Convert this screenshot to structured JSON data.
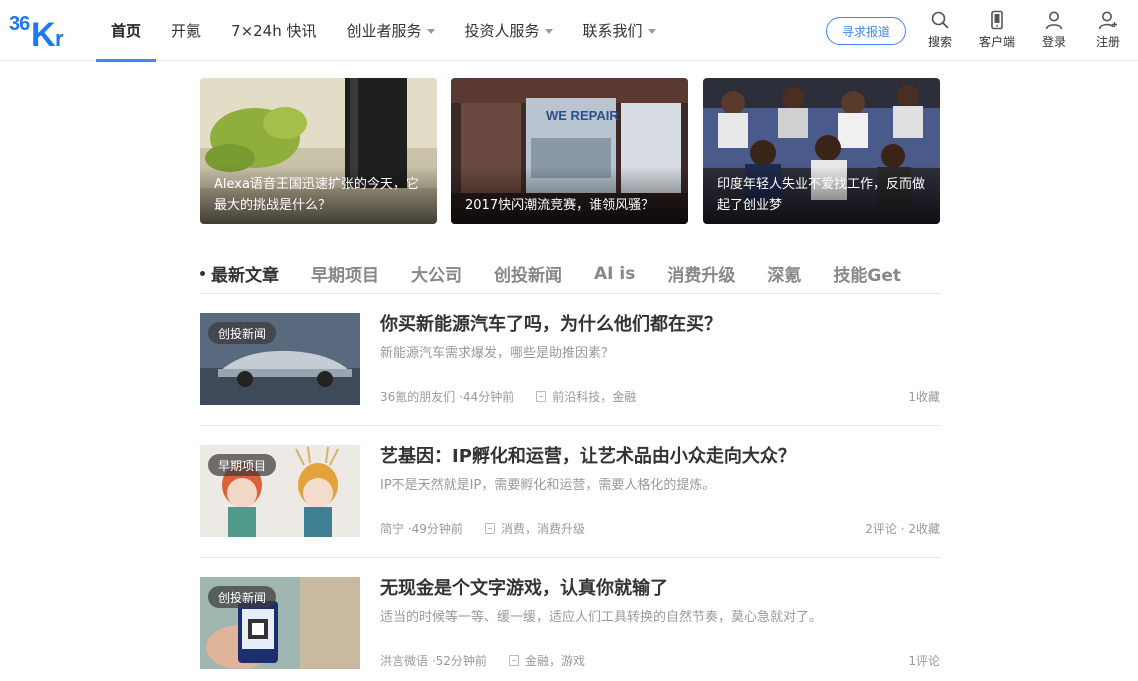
{
  "header": {
    "logo_text": "36Kr",
    "nav": [
      {
        "label": "首页",
        "active": true,
        "dropdown": false
      },
      {
        "label": "开氪",
        "active": false,
        "dropdown": false
      },
      {
        "label": "7×24h 快讯",
        "active": false,
        "dropdown": false
      },
      {
        "label": "创业者服务",
        "active": false,
        "dropdown": true
      },
      {
        "label": "投资人服务",
        "active": false,
        "dropdown": true
      },
      {
        "label": "联系我们",
        "active": false,
        "dropdown": true
      }
    ],
    "seek_report": "寻求报道",
    "icons": [
      {
        "icon": "search-icon",
        "label": "搜索"
      },
      {
        "icon": "mobile-icon",
        "label": "客户端"
      },
      {
        "icon": "user-icon",
        "label": "登录"
      },
      {
        "icon": "add-user-icon",
        "label": "注册"
      }
    ]
  },
  "featured": [
    {
      "caption": "Alexa语音王国迅速扩张的今天，它最大的挑战是什么？"
    },
    {
      "caption": "2017快闪潮流竞赛，谁领风骚？"
    },
    {
      "caption": "印度年轻人失业不爱找工作，反而做起了创业梦"
    }
  ],
  "tabs": [
    "最新文章",
    "早期项目",
    "大公司",
    "创投新闻",
    "AI is",
    "消费升级",
    "深氪",
    "技能Get"
  ],
  "articles": [
    {
      "badge": "创投新闻",
      "title": "你买新能源汽车了吗，为什么他们都在买？",
      "summary": "新能源汽车需求爆发，哪些是助推因素？",
      "author": "36氪的朋友们",
      "time": "44分钟前",
      "tags": "前沿科技，金融",
      "stats": "1收藏"
    },
    {
      "badge": "早期项目",
      "title": "艺基因：IP孵化和运营，让艺术品由小众走向大众？",
      "summary": "IP不是天然就是IP，需要孵化和运营，需要人格化的提炼。",
      "author": "简宁",
      "time": "49分钟前",
      "tags": "消费，消费升级",
      "stats": "2评论 · 2收藏"
    },
    {
      "badge": "创投新闻",
      "title": "无现金是个文字游戏，认真你就输了",
      "summary": "适当的时候等一等、缓一缓，适应人们工具转换的自然节奏，莫心急就对了。",
      "author": "洪言微语",
      "time": "52分钟前",
      "tags": "金融，游戏",
      "stats": "1评论"
    }
  ],
  "colors": {
    "accent": "#4285f4"
  }
}
